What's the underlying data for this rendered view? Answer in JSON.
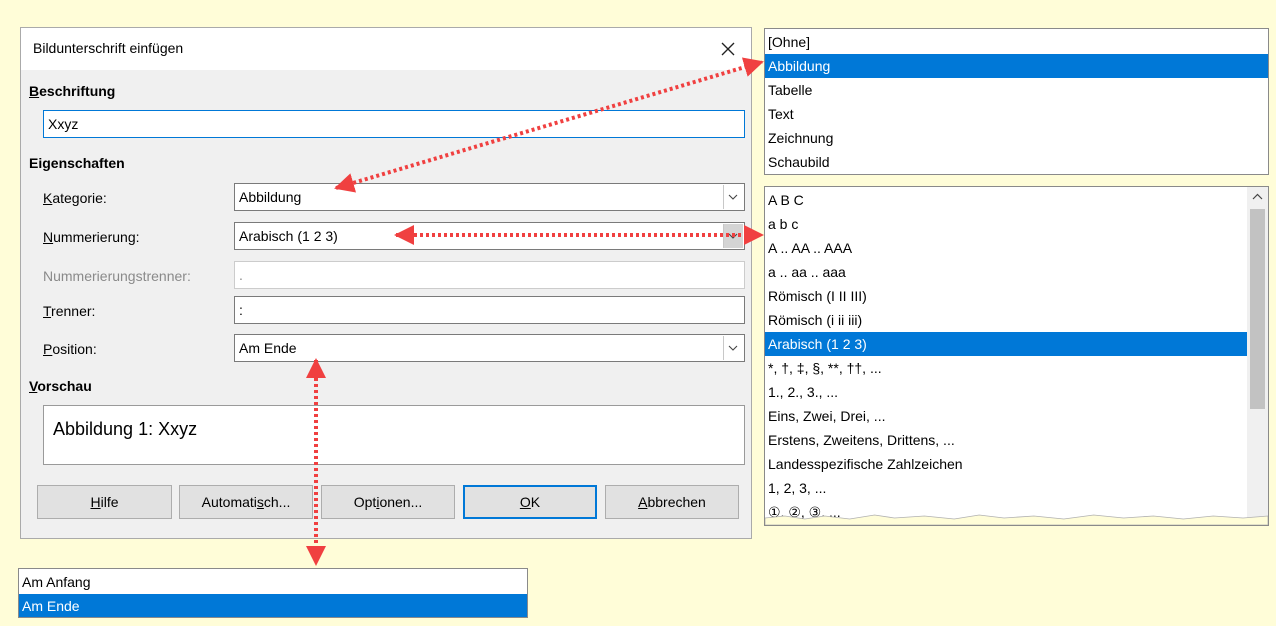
{
  "dialog": {
    "title": "Bildunterschrift einfügen",
    "caption_section": {
      "label_u": "B",
      "label_rest": "eschriftung",
      "value": "Xxyz"
    },
    "properties_section": {
      "label": "Eigenschaften"
    },
    "category": {
      "label_u": "K",
      "label_rest": "ategorie:",
      "value": "Abbildung"
    },
    "numbering": {
      "label_u": "N",
      "label_rest": "ummerierung:",
      "value": "Arabisch (1 2 3)"
    },
    "numbering_separator": {
      "label": "Nummerierungstrenner:",
      "value": "."
    },
    "separator": {
      "label_u": "T",
      "label_rest": "renner:",
      "value": ":"
    },
    "position": {
      "label_u": "P",
      "label_rest": "osition:",
      "value": "Am Ende"
    },
    "preview_section": {
      "label_u": "V",
      "label_rest": "orschau",
      "text": "Abbildung 1: Xxyz"
    },
    "buttons": {
      "help": {
        "u": "H",
        "rest": "ilfe"
      },
      "auto": {
        "pre": "Automati",
        "u": "s",
        "post": "ch..."
      },
      "options": {
        "pre": "Opt",
        "u": "i",
        "post": "onen..."
      },
      "ok": {
        "u": "O",
        "rest": "K"
      },
      "cancel": {
        "u": "A",
        "rest": "bbrechen"
      }
    }
  },
  "category_list": {
    "items": [
      "[Ohne]",
      "Abbildung",
      "Tabelle",
      "Text",
      "Zeichnung",
      "Schaubild"
    ],
    "selected": "Abbildung"
  },
  "numbering_list": {
    "items": [
      "A B C",
      "a b c",
      "A .. AA .. AAA",
      "a .. aa .. aaa",
      "Römisch (I II III)",
      "Römisch (i ii iii)",
      "Arabisch (1 2 3)",
      "*, †, ‡, §, **, ††, ...",
      "1., 2., 3., ...",
      "Eins, Zwei, Drei, ...",
      "Erstens, Zweitens, Drittens, ...",
      "Landesspezifische Zahlzeichen",
      "1, 2, 3, ...",
      "①, ②, ③, ..."
    ],
    "selected": "Arabisch (1 2 3)"
  },
  "position_list": {
    "items": [
      "Am Anfang",
      "Am Ende"
    ],
    "selected": "Am Ende"
  },
  "colors": {
    "selection": "#0078d7",
    "arrow": "#f04040",
    "note_bg": "#fffdd8"
  }
}
